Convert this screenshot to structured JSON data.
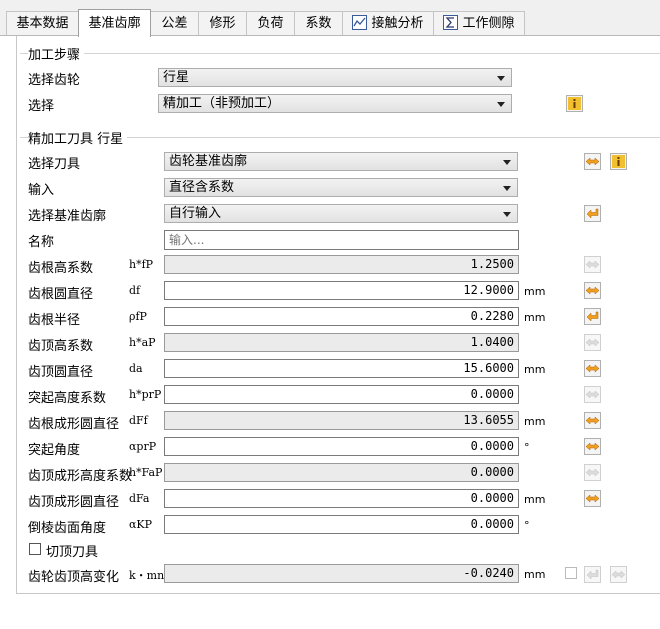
{
  "tabs": [
    {
      "label": "基本数据",
      "active": false
    },
    {
      "label": "基准齿廓",
      "active": true
    },
    {
      "label": "公差",
      "active": false
    },
    {
      "label": "修形",
      "active": false
    },
    {
      "label": "负荷",
      "active": false
    },
    {
      "label": "系数",
      "active": false
    },
    {
      "label": "接触分析",
      "active": false,
      "icon": "contact-analysis-icon"
    },
    {
      "label": "工作侧隙",
      "active": false,
      "icon": "sum-icon"
    }
  ],
  "process": {
    "title": "加工步骤",
    "select_gear_label": "选择齿轮",
    "select_gear_value": "行星",
    "select_label": "选择",
    "select_value": "精加工（非预加工）"
  },
  "tool": {
    "title": "精加工刀具 行星",
    "select_tool_label": "选择刀具",
    "select_tool_value": "齿轮基准齿廓",
    "input_label": "输入",
    "input_value": "直径含系数",
    "ref_profile_label": "选择基准齿廓",
    "ref_profile_value": "自行输入",
    "name_label": "名称",
    "name_placeholder": "输入..."
  },
  "params": [
    {
      "label": "齿根高系数",
      "symbol": "h*fP",
      "value": "1.2500",
      "unit": "",
      "readonly": true
    },
    {
      "label": "齿根圆直径",
      "symbol": "df",
      "value": "12.9000",
      "unit": "mm",
      "readonly": false
    },
    {
      "label": "齿根半径",
      "symbol": "ρfP",
      "value": "0.2280",
      "unit": "mm",
      "readonly": false
    },
    {
      "label": "齿顶高系数",
      "symbol": "h*aP",
      "value": "1.0400",
      "unit": "",
      "readonly": true
    },
    {
      "label": "齿顶圆直径",
      "symbol": "da",
      "value": "15.6000",
      "unit": "mm",
      "readonly": false
    },
    {
      "label": "突起高度系数",
      "symbol": "h*prP",
      "value": "0.0000",
      "unit": "",
      "readonly": false
    },
    {
      "label": "齿根成形圆直径",
      "symbol": "dFf",
      "value": "13.6055",
      "unit": "mm",
      "readonly": true
    },
    {
      "label": "突起角度",
      "symbol": "αprP",
      "value": "0.0000",
      "unit": "°",
      "readonly": false
    },
    {
      "label": "齿顶成形高度系数",
      "symbol": "h*FaP",
      "value": "0.0000",
      "unit": "",
      "readonly": true
    },
    {
      "label": "齿顶成形圆直径",
      "symbol": "dFa",
      "value": "0.0000",
      "unit": "mm",
      "readonly": false
    },
    {
      "label": "倒棱齿面角度",
      "symbol": "αKP",
      "value": "0.0000",
      "unit": "°",
      "readonly": false
    }
  ],
  "topping_tool_label": "切顶刀具",
  "tip_alt": {
    "label": "齿轮齿顶高变化",
    "symbol": "k・mn",
    "value": "-0.0240",
    "unit": "mm"
  }
}
